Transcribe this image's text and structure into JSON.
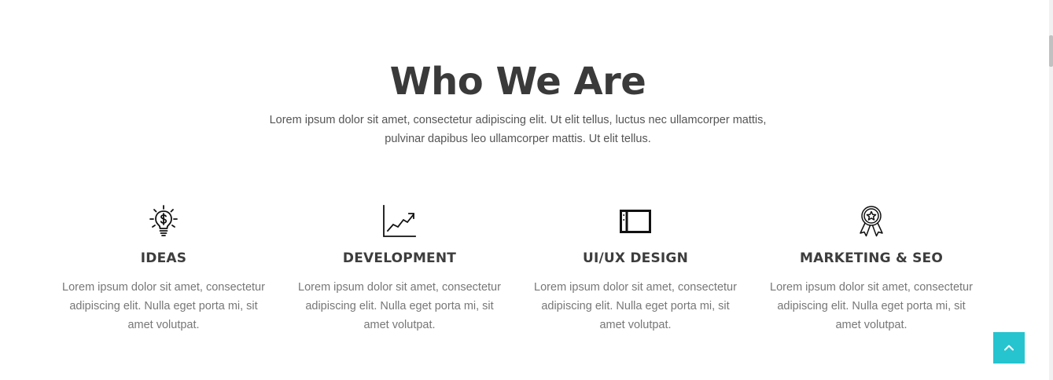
{
  "section": {
    "title": "Who We Are",
    "intro": "Lorem ipsum dolor sit amet, consectetur adipiscing elit. Ut elit tellus, luctus nec ullamcorper mattis, pulvinar dapibus leo ullamcorper mattis. Ut elit tellus."
  },
  "features": [
    {
      "icon": "lightbulb-dollar-icon",
      "title": "IDEAS",
      "text": "Lorem ipsum dolor sit amet, consectetur adipiscing elit. Nulla eget porta mi, sit amet volutpat."
    },
    {
      "icon": "growth-chart-icon",
      "title": "DEVELOPMENT",
      "text": "Lorem ipsum dolor sit amet, consectetur adipiscing elit. Nulla eget porta mi, sit amet volutpat."
    },
    {
      "icon": "browser-window-icon",
      "title": "UI/UX DESIGN",
      "text": "Lorem ipsum dolor sit amet, consectetur adipiscing elit. Nulla eget porta mi, sit amet volutpat."
    },
    {
      "icon": "award-badge-icon",
      "title": "MARKETING & SEO",
      "text": "Lorem ipsum dolor sit amet, consectetur adipiscing elit. Nulla eget porta mi, sit amet volutpat."
    }
  ],
  "scroll_top": {
    "icon": "chevron-up-icon",
    "color": "#25c4cf"
  },
  "colors": {
    "heading": "#3a3a3a",
    "body_text": "#777777",
    "accent": "#25c4cf"
  }
}
